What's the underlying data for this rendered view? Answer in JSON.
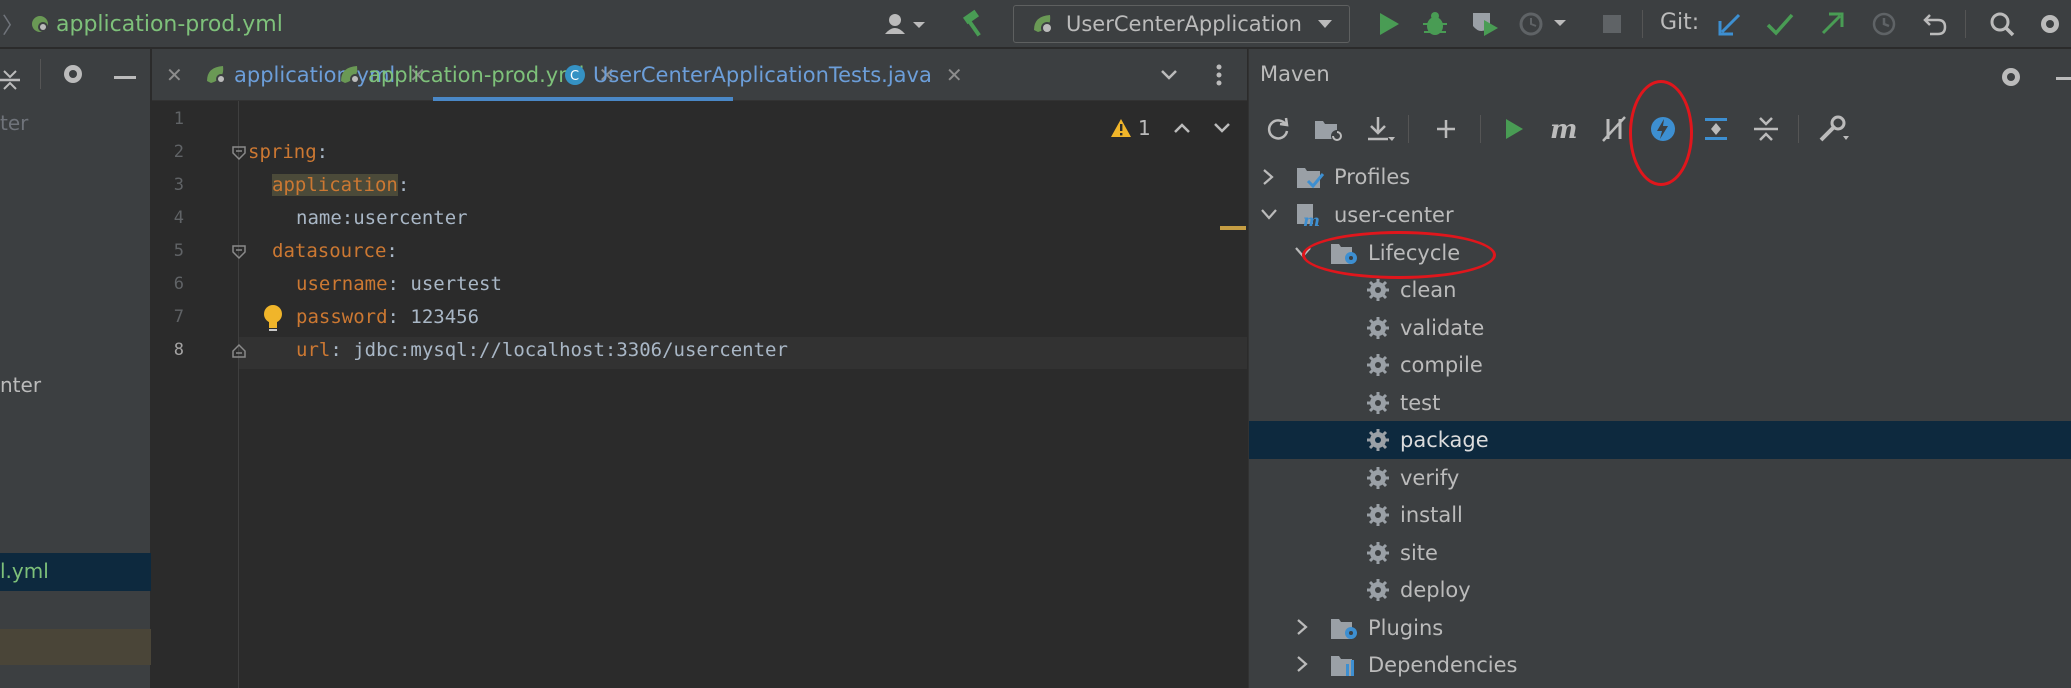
{
  "topbar": {
    "file_breadcrumb": "application-prod.yml",
    "run_config": "UserCenterApplication",
    "git_label": "Git:"
  },
  "left_panel": {
    "items": [
      "ter",
      "nter",
      "l.yml"
    ]
  },
  "editor": {
    "tabs": [
      {
        "label": "application.yml",
        "color": "#6c9ed9",
        "active": false
      },
      {
        "label": "application-prod.yml",
        "color": "#7ec17a",
        "active": true
      },
      {
        "label": "UserCenterApplicationTests.java",
        "color": "#6c9ed9",
        "active": false
      }
    ],
    "warning_count": "1",
    "lines": [
      "1",
      "2",
      "3",
      "4",
      "5",
      "6",
      "7",
      "8"
    ],
    "code": {
      "l2_key": "spring",
      "l3_key": "application",
      "l4_text": "name:usercenter",
      "l5_key": "datasource",
      "l6_key": "username",
      "l6_val": " usertest",
      "l7_key": "password",
      "l7_val": " 123456",
      "l8_key": "url",
      "l8_val": " jdbc:mysql://localhost:3306/usercenter",
      "colon": ":"
    }
  },
  "maven": {
    "title": "Maven",
    "tree": {
      "profiles": "Profiles",
      "project": "user-center",
      "lifecycle": "Lifecycle",
      "phases": [
        "clean",
        "validate",
        "compile",
        "test",
        "package",
        "verify",
        "install",
        "site",
        "deploy"
      ],
      "plugins": "Plugins",
      "dependencies": "Dependencies"
    },
    "selected_phase": "package"
  },
  "colors": {
    "accent_blue": "#4a88c7",
    "run_green": "#499c54",
    "annotation_red": "#e0161c",
    "selection": "#0d293e"
  }
}
